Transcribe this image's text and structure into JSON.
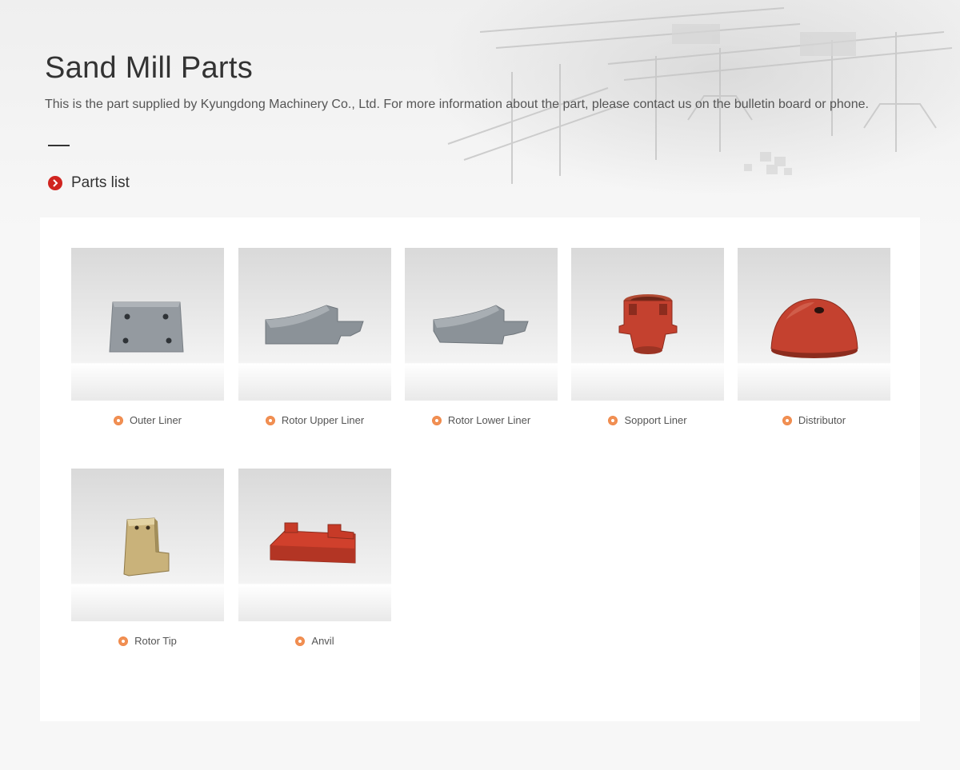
{
  "header": {
    "title": "Sand Mill Parts",
    "description": "This is the part supplied by Kyungdong Machinery Co., Ltd. For more information about the part, please contact us on the bulletin board or phone."
  },
  "section": {
    "title": "Parts list",
    "icon": "chevron-right-icon"
  },
  "colors": {
    "accent": "#d0241f",
    "label_dot": "#f08a4b",
    "part_red": "#c4412f",
    "part_steel": "#8e969c"
  },
  "parts": [
    {
      "label": "Outer Liner"
    },
    {
      "label": "Rotor Upper Liner"
    },
    {
      "label": "Rotor Lower Liner"
    },
    {
      "label": "Sopport Liner"
    },
    {
      "label": "Distributor"
    },
    {
      "label": "Rotor Tip"
    },
    {
      "label": "Anvil"
    }
  ]
}
